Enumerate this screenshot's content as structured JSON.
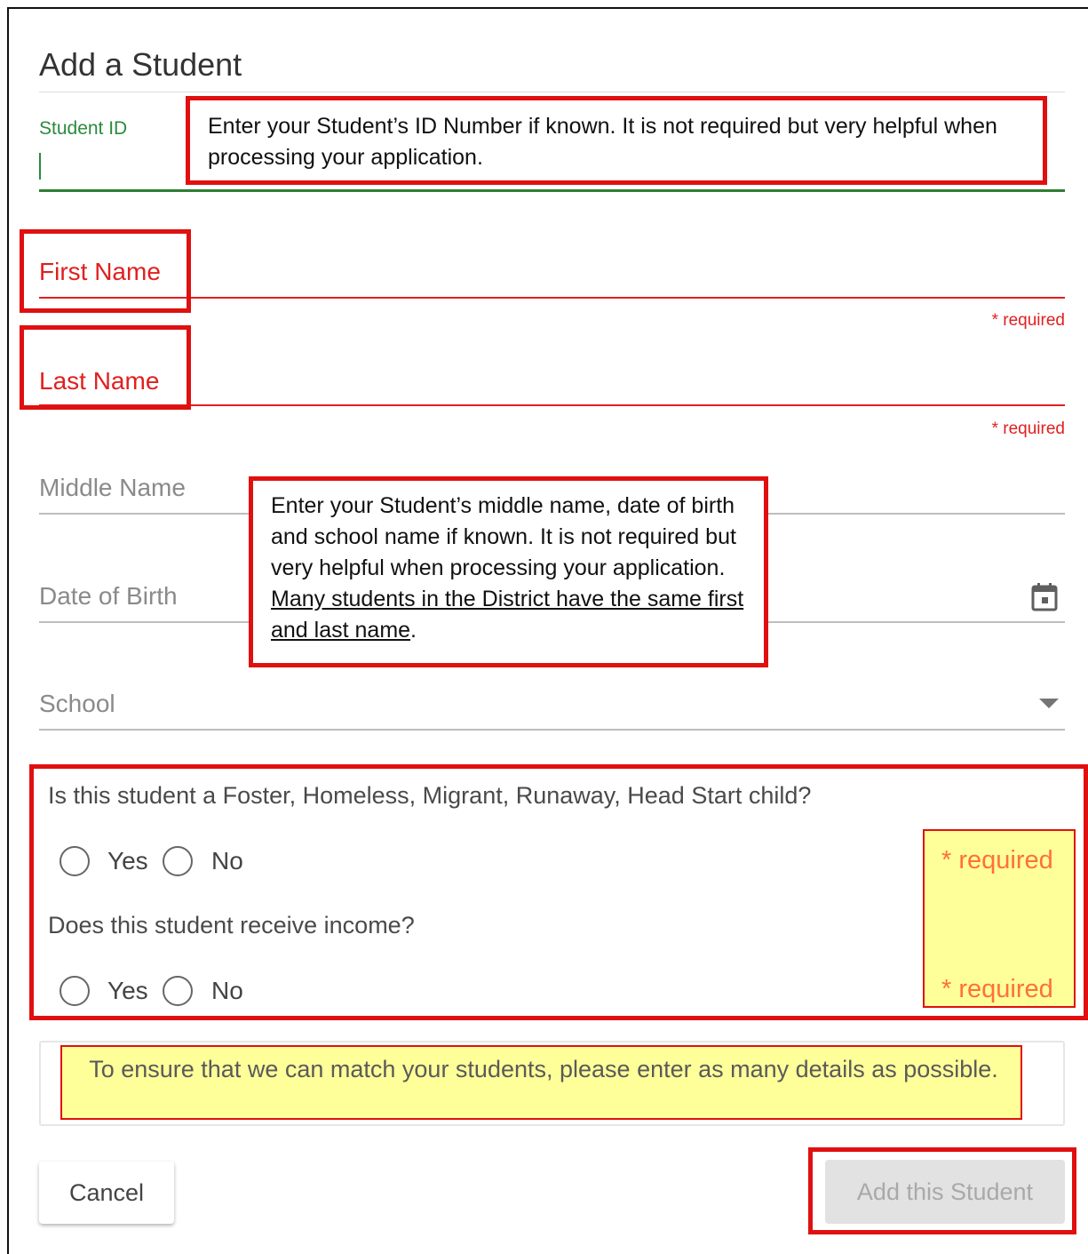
{
  "dialog": {
    "title": "Add a Student",
    "student_id": {
      "label": "Student ID",
      "value": ""
    },
    "first_name": {
      "label": "First Name",
      "hint": "* required"
    },
    "last_name": {
      "label": "Last Name",
      "hint": "* required"
    },
    "middle_name": {
      "label": "Middle Name"
    },
    "date_of_birth": {
      "label": "Date of Birth",
      "icon": "calendar-icon"
    },
    "school": {
      "label": "School",
      "icon": "dropdown-arrow-icon"
    },
    "question1": {
      "text": "Is this student a Foster, Homeless, Migrant, Runaway, Head Start child?",
      "yes": "Yes",
      "no": "No"
    },
    "question2": {
      "text": "Does this student receive income?",
      "yes": "Yes",
      "no": "No"
    },
    "required_marker": "* required",
    "info_message": "To ensure that we can match your students, please enter as many details as possible.",
    "cancel_label": "Cancel",
    "add_label": "Add this Student"
  },
  "annotations": {
    "student_id_note": "Enter your Student’s ID Number if known.  It is not required but very helpful when processing your application.",
    "middle_note_part1": "Enter your Student’s middle name, date of birth and school name if known.  It is not required but very helpful when processing your application.  ",
    "middle_note_underlined": "Many students in the District have the same first and last name",
    "middle_note_end": "."
  },
  "colors": {
    "focus_green": "#2e7d32",
    "error_red": "#e0201f",
    "annotation_red": "#e01010",
    "highlight_yellow": "#ffff99",
    "required_orange": "#ff6f3c"
  }
}
